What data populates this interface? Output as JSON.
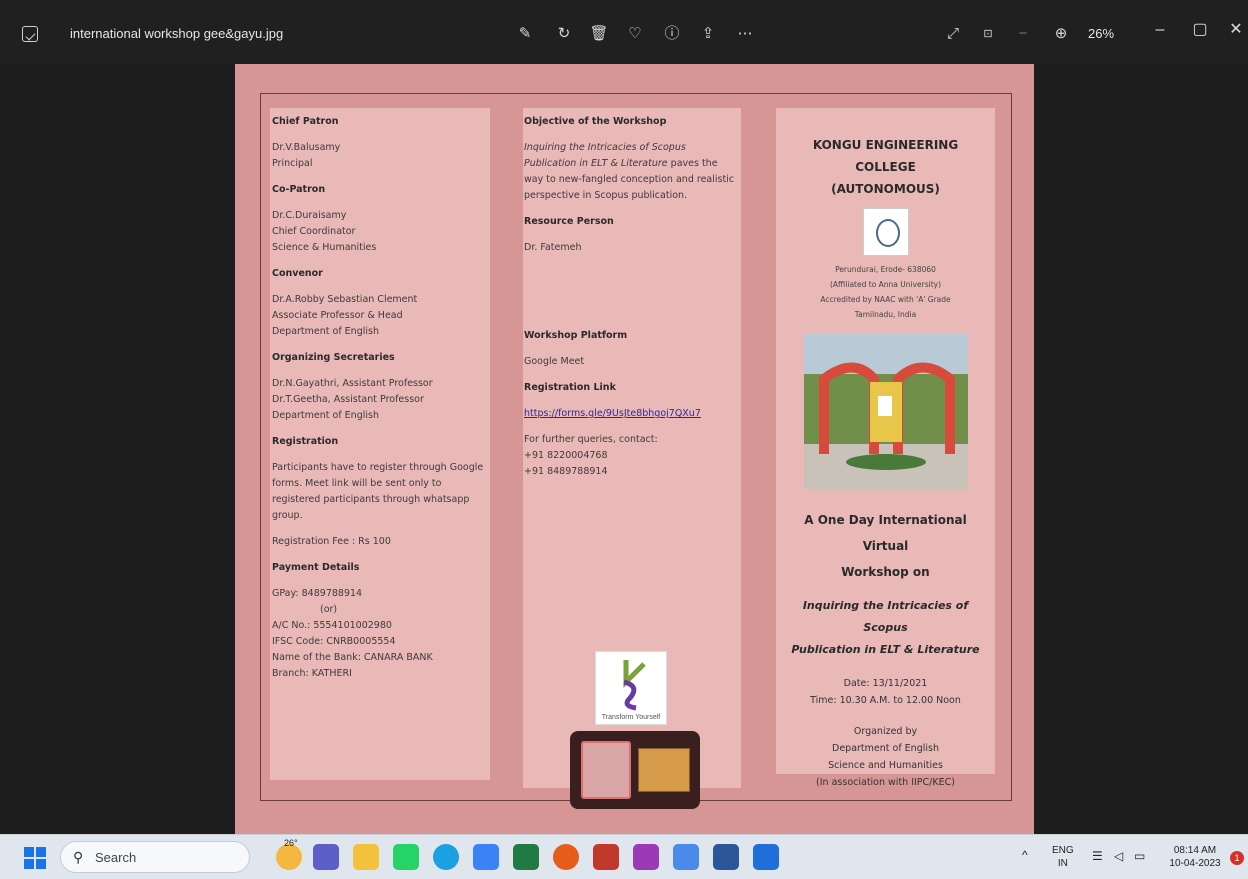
{
  "window": {
    "title": "international workshop gee&gayu.jpg",
    "zoom": "26%"
  },
  "panel1": {
    "chief_patron_h": "Chief Patron",
    "chief_patron": [
      "Dr.V.Balusamy",
      "Principal"
    ],
    "co_patron_h": "Co-Patron",
    "co_patron": [
      "Dr.C.Duraisamy",
      "Chief Coordinator",
      "Science & Humanities"
    ],
    "convenor_h": "Convenor",
    "convenor": [
      "Dr.A.Robby Sebastian Clement",
      "Associate Professor & Head",
      "Department of English"
    ],
    "org_h": "Organizing Secretaries",
    "org": [
      "Dr.N.Gayathri, Assistant Professor",
      "Dr.T.Geetha, Assistant Professor",
      "Department of English"
    ],
    "registration_h": "Registration",
    "registration": "Participants have to register through Google forms. Meet link will be sent only to registered participants through whatsapp group.",
    "fee": "Registration Fee : Rs 100",
    "payment_h": "Payment Details",
    "payment": [
      "GPay: 8489788914",
      "(or)",
      "A/C No.: 5554101002980",
      "IFSC Code: CNRB0005554",
      "Name of the Bank: CANARA BANK",
      "Branch: KATHERI"
    ]
  },
  "panel2": {
    "objective_h": "Objective of the Workshop",
    "objective_italic": "Inquiring the Intricacies of Scopus Publication in ELT & Literature",
    "objective_rest": " paves the way to new-fangled conception and realistic perspective in Scopus publication.",
    "resource_h": "Resource Person",
    "resource": "Dr. Fatemeh",
    "platform_h": "Workshop Platform",
    "platform": "Google Meet",
    "reglink_h": "Registration Link",
    "reglink": "https://forms.gle/9UsJte8bhgoj7QXu7",
    "queries": "For further queries, contact:",
    "phones": [
      "+91 8220004768",
      "+91 8489788914"
    ],
    "logo_text": "Transform Yourself"
  },
  "panel3": {
    "college": "KONGU ENGINEERING COLLEGE",
    "autonomous": "(AUTONOMOUS)",
    "address": [
      "Perundurai, Erode- 638060",
      "(Affiliated to Anna University)",
      "Accredited by NAAC with 'A' Grade",
      "Tamilnadu, India"
    ],
    "workshop": [
      "A One Day International Virtual",
      "Workshop on"
    ],
    "topic": [
      "Inquiring the Intricacies of Scopus",
      "Publication in ELT & Literature"
    ],
    "date": "Date: 13/11/2021",
    "time": "Time: 10.30 A.M. to 12.00 Noon",
    "organized": [
      "Organized by",
      "Department of English",
      "Science and Humanities",
      "(In association with IIPC/KEC)"
    ]
  },
  "taskbar": {
    "search_placeholder": "Search",
    "weather": "26°",
    "lang": [
      "ENG",
      "IN"
    ],
    "time": "08:14 AM",
    "date": "10-04-2023",
    "notification_count": "1"
  }
}
